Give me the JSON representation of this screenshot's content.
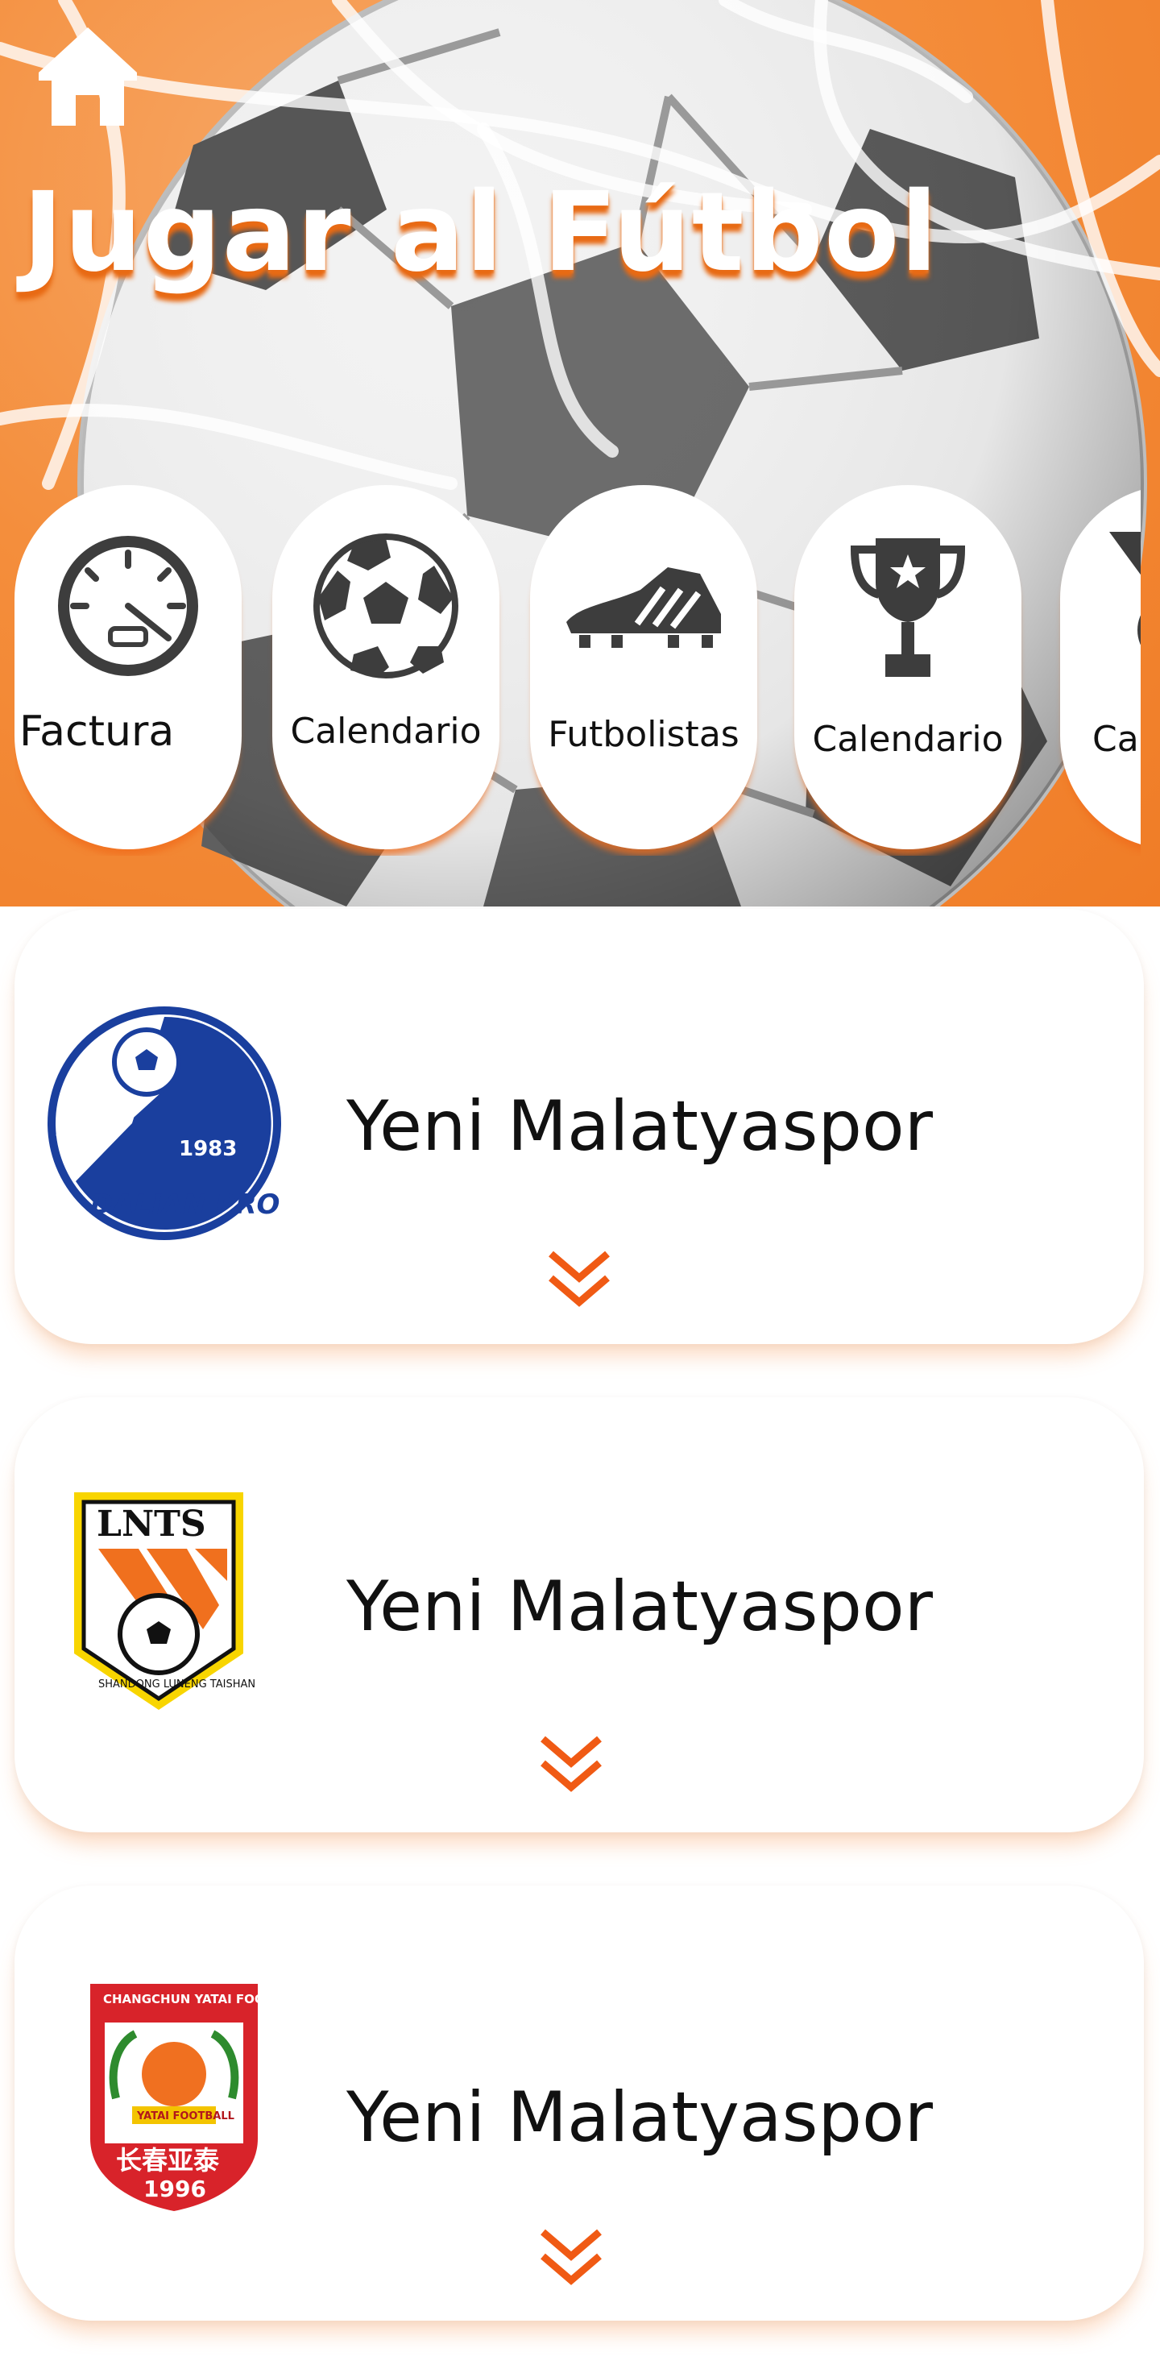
{
  "header": {
    "title": "Jugar al Fútbol",
    "home_icon": "home-icon"
  },
  "categories": [
    {
      "label": "Factura",
      "icon": "speedometer-icon"
    },
    {
      "label": "Calendario",
      "icon": "soccer-ball-icon"
    },
    {
      "label": "Futbolistas",
      "icon": "football-boot-icon"
    },
    {
      "label": "Calendario",
      "icon": "trophy-icon"
    },
    {
      "label": "Ca",
      "icon": "medal-icon"
    }
  ],
  "teams": [
    {
      "name": "Yeni Malatyaspor",
      "logo": "dalian-pro-logo",
      "logo_text": [
        "DALIAN PRO",
        "1983"
      ]
    },
    {
      "name": "Yeni Malatyaspor",
      "logo": "shandong-taishan-logo",
      "logo_text": [
        "LNTS",
        "SHANDONG LUNENG TAISHAN"
      ]
    },
    {
      "name": "Yeni Malatyaspor",
      "logo": "changchun-yatai-logo",
      "logo_text": [
        "CHANGCHUN YATAI FOOTBALL CLUB",
        "YATAI FOOTBALL",
        "长春亚泰",
        "1996"
      ]
    }
  ],
  "colors": {
    "accent": "#f05a14",
    "hero_orange": "#f48e3c",
    "card_bg": "#ffffff",
    "icon_gray": "#3d3d3d"
  }
}
